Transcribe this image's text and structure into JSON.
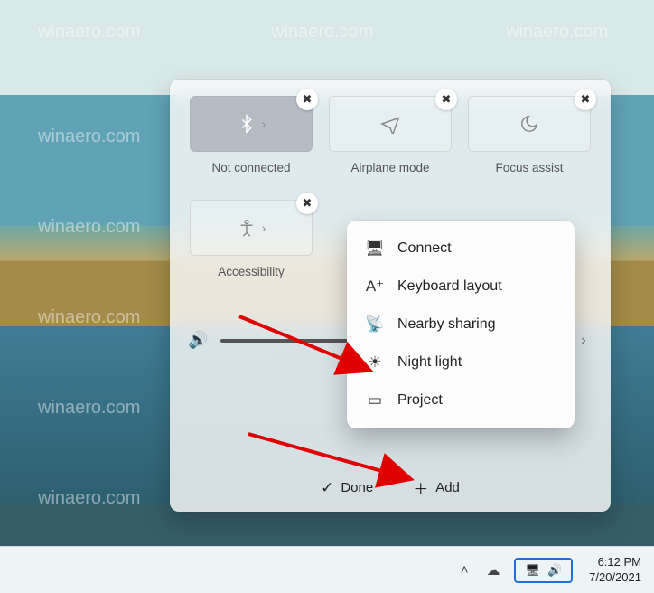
{
  "panel": {
    "tiles": [
      {
        "id": "bluetooth",
        "label": "Not connected",
        "icon": "bluetooth-icon",
        "active": true,
        "has_chevron": true
      },
      {
        "id": "airplane",
        "label": "Airplane mode",
        "icon": "airplane-icon",
        "active": false,
        "has_chevron": false
      },
      {
        "id": "focus",
        "label": "Focus assist",
        "icon": "moon-icon",
        "active": false,
        "has_chevron": false
      },
      {
        "id": "access",
        "label": "Accessibility",
        "icon": "accessibility-icon",
        "active": false,
        "has_chevron": true
      }
    ],
    "footer": {
      "done_label": "Done",
      "add_label": "Add"
    }
  },
  "add_menu": {
    "items": [
      {
        "icon": "connect-icon",
        "label": "Connect"
      },
      {
        "icon": "keyboard-icon",
        "label": "Keyboard layout"
      },
      {
        "icon": "nearby-icon",
        "label": "Nearby sharing"
      },
      {
        "icon": "nightlight-icon",
        "label": "Night light"
      },
      {
        "icon": "project-icon",
        "label": "Project"
      }
    ]
  },
  "taskbar": {
    "time": "6:12 PM",
    "date": "7/20/2021"
  },
  "watermark": "winaero.com"
}
